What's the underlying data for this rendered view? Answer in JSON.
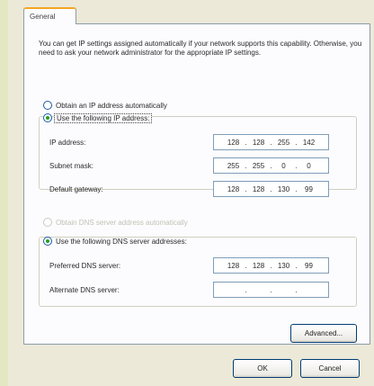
{
  "tab": {
    "general": "General"
  },
  "description": "You can get IP settings assigned automatically if your network supports this capability. Otherwise, you need to ask your network administrator for the appropriate IP settings.",
  "ip_mode": {
    "auto_label": "Obtain an IP address automatically",
    "auto_selected": false,
    "manual_label": "Use the following IP address:",
    "manual_selected": true
  },
  "fields": {
    "ip_address": {
      "label": "IP address:",
      "octets": [
        "128",
        "128",
        "255",
        "142"
      ]
    },
    "subnet_mask": {
      "label": "Subnet mask:",
      "octets": [
        "255",
        "255",
        "0",
        "0"
      ]
    },
    "default_gateway": {
      "label": "Default gateway:",
      "octets": [
        "128",
        "128",
        "130",
        "99"
      ]
    }
  },
  "dns_mode": {
    "auto_label": "Obtain DNS server address automatically",
    "auto_enabled": false,
    "manual_label": "Use the following DNS server addresses:",
    "manual_selected": true
  },
  "dns": {
    "preferred": {
      "label": "Preferred DNS server:",
      "octets": [
        "128",
        "128",
        "130",
        "99"
      ]
    },
    "alternate": {
      "label": "Alternate DNS server:",
      "octets": [
        "",
        "",
        "",
        ""
      ]
    }
  },
  "buttons": {
    "advanced": "Advanced...",
    "ok": "OK",
    "cancel": "Cancel"
  },
  "colors": {
    "selected_radio": "#21a121",
    "tab_highlight": "#f5a623",
    "field_border": "#7f9db9"
  }
}
